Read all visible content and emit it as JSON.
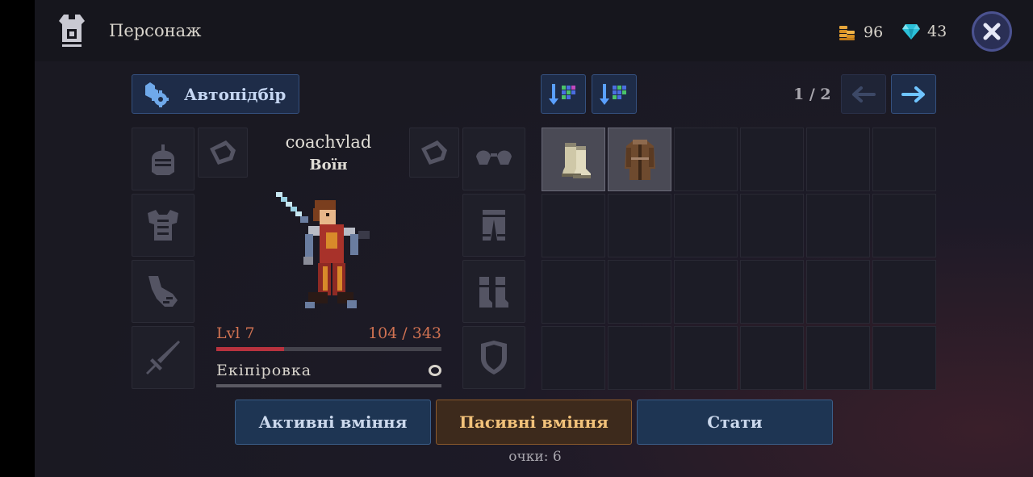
{
  "header": {
    "title": "Персонаж",
    "gold": "96",
    "gems": "43"
  },
  "autoequip": {
    "label": "Автопідбір"
  },
  "character": {
    "name": "coachvlad",
    "class": "Воїн",
    "level_label": "Lvl 7",
    "xp": "104 / 343",
    "xp_fraction": 0.3,
    "equipment_label": "Екіпіровка"
  },
  "inventory": {
    "page": "1 / 2",
    "items": [
      "boots",
      "coat"
    ]
  },
  "buttons": {
    "active_skills": "Активні вміння",
    "passive_skills": "Пасивні вміння",
    "stats": "Стати"
  },
  "points": "очки: 6",
  "colors": {
    "accent_blue": "#1e2c48",
    "accent_orange": "#f2c27a",
    "xp_bar": "#b8323e",
    "level_text": "#d07252"
  }
}
